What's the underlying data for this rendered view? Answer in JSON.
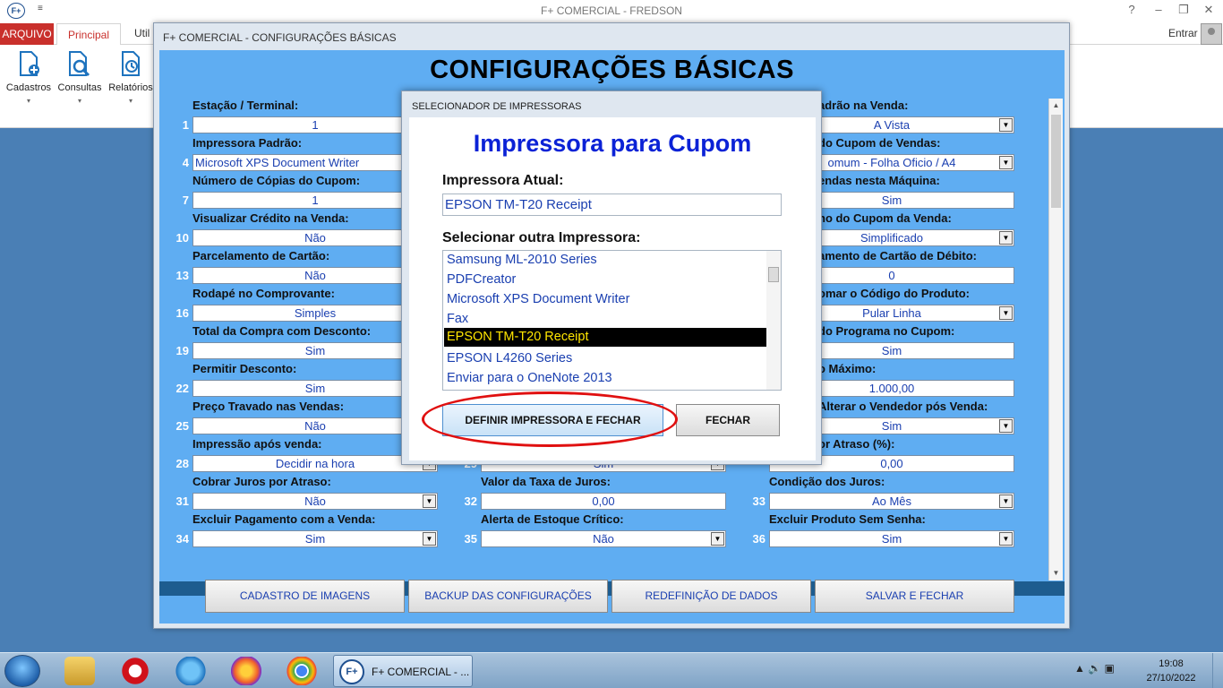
{
  "app": {
    "title": "F+ COMERCIAL - FREDSON",
    "logo": "F+",
    "quick_access": "≡",
    "controls": [
      "?",
      "–",
      "❐",
      "✕"
    ],
    "entrar": "Entrar"
  },
  "ribbon": {
    "tabs": [
      "ARQUIVO",
      "Principal",
      "Util"
    ],
    "buttons": [
      {
        "label": "Cadastros",
        "icon": "document-add-icon"
      },
      {
        "label": "Consultas",
        "icon": "document-search-icon"
      },
      {
        "label": "Relatórios",
        "icon": "report-icon"
      }
    ],
    "caret": "▾"
  },
  "config": {
    "window_title": "F+ COMERCIAL - CONFIGURAÇÕES BÁSICAS",
    "heading": "CONFIGURAÇÕES BÁSICAS",
    "fields": [
      {
        "num": "1",
        "label": "Estação / Terminal:",
        "value": "1",
        "dropdown": false
      },
      {
        "num": "4",
        "label": "Impressora Padrão:",
        "value": "Microsoft XPS Document Writer",
        "dropdown": false,
        "align": "left"
      },
      {
        "num": "7",
        "label": "Número de Cópias do Cupom:",
        "value": "1",
        "dropdown": false
      },
      {
        "num": "10",
        "label": "Visualizar Crédito na Venda:",
        "value": "Não",
        "dropdown": false
      },
      {
        "num": "13",
        "label": "Parcelamento de Cartão:",
        "value": "Não",
        "dropdown": false
      },
      {
        "num": "16",
        "label": "Rodapé no Comprovante:",
        "value": "Simples",
        "dropdown": false
      },
      {
        "num": "19",
        "label": "Total da Compra com Desconto:",
        "value": "Sim",
        "dropdown": false
      },
      {
        "num": "22",
        "label": "Permitir Desconto:",
        "value": "Sim",
        "dropdown": false
      },
      {
        "num": "25",
        "label": "Preço Travado nas Vendas:",
        "value": "Não",
        "dropdown": false
      },
      {
        "num": "28",
        "label": "Impressão após venda:",
        "value": "Decidir na hora",
        "dropdown": true
      },
      {
        "num": "31",
        "label": "Cobrar Juros por Atraso:",
        "value": "Não",
        "dropdown": true
      },
      {
        "num": "34",
        "label": "Excluir Pagamento com a Venda:",
        "value": "Sim",
        "dropdown": true
      },
      {
        "num": "",
        "label": "",
        "value": "Sim",
        "dropdown": true
      },
      {
        "num": "32",
        "label": "Valor da Taxa de Juros:",
        "value": "0,00",
        "dropdown": false
      },
      {
        "num": "35",
        "label": "Alerta de Estoque Crítico:",
        "value": "Não",
        "dropdown": true
      },
      {
        "num": "",
        "label": "adrão na Venda:",
        "value": "A Vista",
        "dropdown": true
      },
      {
        "num": "",
        "label": "do Cupom de Vendas:",
        "value": "omum - Folha Oficio / A4",
        "dropdown": true
      },
      {
        "num": "",
        "label": "endas nesta Máquina:",
        "value": "Sim",
        "dropdown": false
      },
      {
        "num": "",
        "label": "ho do Cupom da Venda:",
        "value": "Simplificado",
        "dropdown": true
      },
      {
        "num": "",
        "label": "amento de Cartão de Débito:",
        "value": "0",
        "dropdown": false
      },
      {
        "num": "",
        "label": "omar o Código do Produto:",
        "value": "Pular Linha",
        "dropdown": true
      },
      {
        "num": "",
        "label": "do Programa no Cupom:",
        "value": "Sim",
        "dropdown": false
      },
      {
        "num": "",
        "label": "o Máximo:",
        "value": "1.000,00",
        "dropdown": false
      },
      {
        "num": "",
        "label": "Alterar o Vendedor pós Venda:",
        "value": "Sim",
        "dropdown": true
      },
      {
        "num": "",
        "label": "or Atraso (%):",
        "value": "0,00",
        "dropdown": false
      },
      {
        "num": "33",
        "label": "Condição dos Juros:",
        "value": "Ao Mês",
        "dropdown": true
      },
      {
        "num": "36",
        "label": "Excluir Produto Sem Senha:",
        "value": "Sim",
        "dropdown": true
      }
    ],
    "partial_num": "29",
    "partial_value": "Sim",
    "footer_buttons": [
      "CADASTRO DE IMAGENS",
      "BACKUP DAS CONFIGURAÇÕES",
      "REDEFINIÇÃO DE DADOS",
      "SALVAR E FECHAR"
    ]
  },
  "modal": {
    "title": "SELECIONADOR DE IMPRESSORAS",
    "heading": "Impressora para Cupom",
    "current_label": "Impressora Atual:",
    "current_value": "EPSON TM-T20 Receipt",
    "select_label": "Selecionar outra Impressora:",
    "printers": [
      "Samsung ML-2010 Series",
      "PDFCreator",
      "Microsoft XPS Document Writer",
      "Fax",
      "EPSON TM-T20 Receipt",
      "EPSON L4260 Series",
      "Enviar para o OneNote 2013"
    ],
    "selected_index": 4,
    "btn_define": "DEFINIR IMPRESSORA E FECHAR",
    "btn_close": "FECHAR"
  },
  "taskbar": {
    "task_label": "F+ COMERCIAL - ...",
    "task_icon": "F+",
    "time": "19:08",
    "date": "27/10/2022",
    "tray_icons": "▲  🔊  ▣",
    "colors": {
      "start": "#1e5ea8",
      "accent": "#c9302c"
    }
  }
}
